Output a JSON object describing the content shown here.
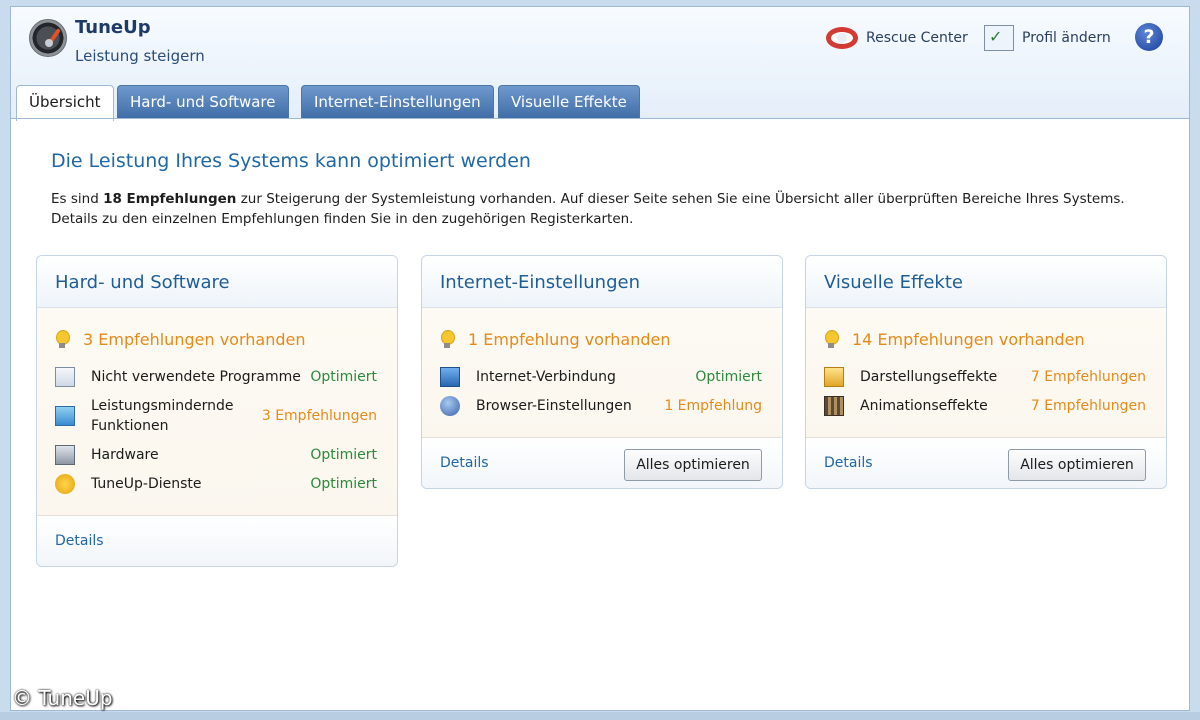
{
  "app": {
    "title": "TuneUp",
    "subtitle": "Leistung steigern"
  },
  "toolbar": {
    "rescue_label": "Rescue Center",
    "profile_label": "Profil ändern",
    "help_label": "?"
  },
  "tabs": [
    {
      "label": "Übersicht",
      "active": true
    },
    {
      "label": "Hard- und Software",
      "active": false
    },
    {
      "label": "Internet-Einstellungen",
      "active": false
    },
    {
      "label": "Visuelle Effekte",
      "active": false
    }
  ],
  "main": {
    "headline": "Die Leistung Ihres Systems kann optimiert werden",
    "intro_prefix": "Es sind ",
    "intro_bold": "18 Empfehlungen",
    "intro_suffix": " zur Steigerung der Systemleistung vorhanden. Auf dieser Seite sehen Sie eine Übersicht aller überprüften Bereiche Ihres Systems. Details zu den einzelnen Empfehlungen finden Sie in den zugehörigen Registerkarten."
  },
  "cards": [
    {
      "title": "Hard- und Software",
      "recommendation": "3 Empfehlungen vorhanden",
      "items": [
        {
          "label": "Nicht verwendete Programme",
          "value": "Optimiert"
        },
        {
          "label": "Leistungsmindernde Funktionen",
          "value": "3 Empfehlungen"
        },
        {
          "label": "Hardware",
          "value": "Optimiert"
        },
        {
          "label": "TuneUp-Dienste",
          "value": "Optimiert"
        }
      ],
      "details_label": "Details"
    },
    {
      "title": "Internet-Einstellungen",
      "recommendation": "1 Empfehlung vorhanden",
      "items": [
        {
          "label": "Internet-Verbindung",
          "value": "Optimiert"
        },
        {
          "label": "Browser-Einstellungen",
          "value": "1 Empfehlung"
        }
      ],
      "details_label": "Details",
      "button_label": "Alles optimieren"
    },
    {
      "title": "Visuelle Effekte",
      "recommendation": "14 Empfehlungen vorhanden",
      "items": [
        {
          "label": "Darstellungseffekte",
          "value": "7 Empfehlungen"
        },
        {
          "label": "Animationseffekte",
          "value": "7 Empfehlungen"
        }
      ],
      "details_label": "Details",
      "button_label": "Alles optimieren"
    }
  ],
  "watermark": "© TuneUp",
  "colors": {
    "accent_blue": "#2067a6",
    "ok_green": "#2a8a3b",
    "warn_orange": "#e48a1a",
    "tab_blue": "#3f6ca6"
  }
}
